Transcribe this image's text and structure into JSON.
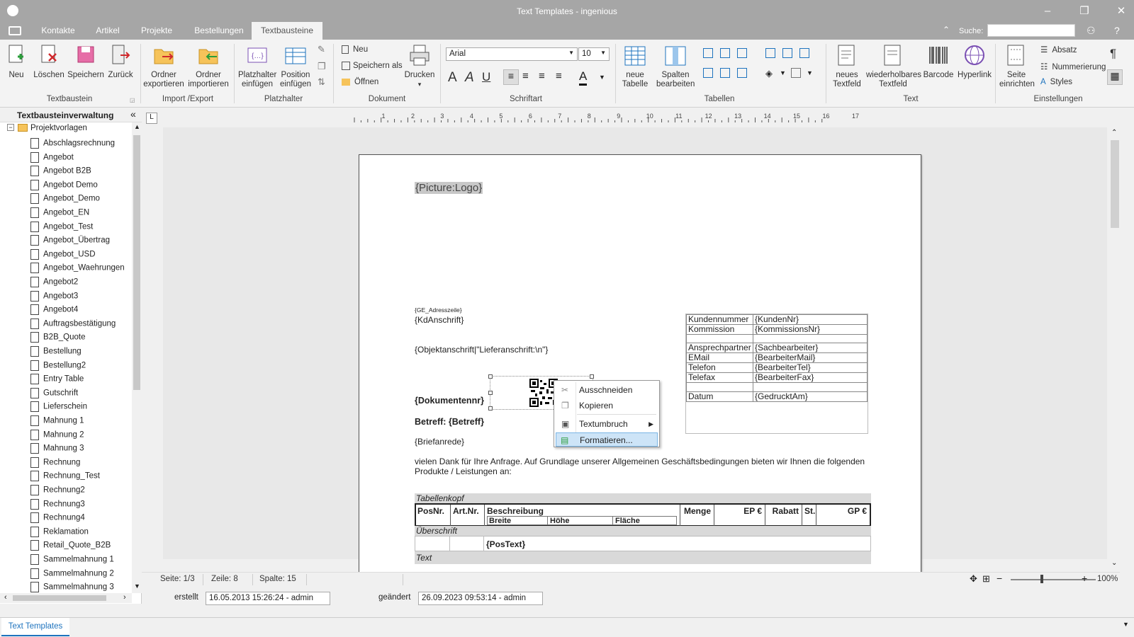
{
  "window": {
    "title": "Text Templates - ingenious"
  },
  "menu": {
    "tabs": [
      "Kontakte",
      "Artikel",
      "Projekte",
      "Bestellungen",
      "Textbausteine"
    ],
    "active": "Textbausteine",
    "search_label": "Suche:",
    "search_value": ""
  },
  "ribbon": {
    "textbaustein": {
      "group": "Textbaustein",
      "neu": "Neu",
      "loeschen": "Löschen",
      "speichern": "Speichern",
      "zurueck": "Zurück"
    },
    "importexport": {
      "group": "Import /Export",
      "export1": "Ordner",
      "export2": "exportieren",
      "import1": "Ordner",
      "import2": "importieren"
    },
    "platzhalter": {
      "group": "Platzhalter",
      "ph1": "Platzhalter",
      "ph2": "einfügen",
      "pos1": "Position",
      "pos2": "einfügen"
    },
    "dokument": {
      "group": "Dokument",
      "neu": "Neu",
      "speichern_als": "Speichern als",
      "oeffnen": "Öffnen",
      "drucken": "Drucken"
    },
    "schriftart": {
      "group": "Schriftart",
      "font": "Arial",
      "size": "10"
    },
    "tabellen": {
      "group": "Tabellen",
      "neue1": "neue",
      "neue2": "Tabelle",
      "spalten1": "Spalten",
      "spalten2": "bearbeiten"
    },
    "text": {
      "group": "Text",
      "neues1": "neues",
      "neues2": "Textfeld",
      "wieder1": "wiederholbares",
      "wieder2": "Textfeld",
      "barcode": "Barcode",
      "hyperlink": "Hyperlink"
    },
    "einstellungen": {
      "group": "Einstellungen",
      "seite1": "Seite",
      "seite2": "einrichten",
      "absatz": "Absatz",
      "nummerierung": "Nummerierung",
      "styles": "Styles"
    }
  },
  "sidebar": {
    "title": "Textbausteinverwaltung",
    "folder": "Projektvorlagen",
    "items": [
      "Abschlagsrechnung",
      "Angebot",
      "Angebot B2B",
      "Angebot Demo",
      "Angebot_Demo",
      "Angebot_EN",
      "Angebot_Test",
      "Angebot_Übertrag",
      "Angebot_USD",
      "Angebot_Waehrungen",
      "Angebot2",
      "Angebot3",
      "Angebot4",
      "Auftragsbestätigung",
      "B2B_Quote",
      "Bestellung",
      "Bestellung2",
      "Entry Table",
      "Gutschrift",
      "Lieferschein",
      "Mahnung 1",
      "Mahnung 2",
      "Mahnung 3",
      "Rechnung",
      "Rechnung_Test",
      "Rechnung2",
      "Rechnung3",
      "Rechnung4",
      "Reklamation",
      "Retail_Quote_B2B",
      "Sammelmahnung 1",
      "Sammelmahnung 2",
      "Sammelmahnung 3"
    ]
  },
  "ruler": {
    "numbers": [
      "1",
      "2",
      "3",
      "4",
      "5",
      "6",
      "7",
      "8",
      "9",
      "10",
      "11",
      "12",
      "13",
      "14",
      "15",
      "16",
      "17"
    ]
  },
  "document": {
    "logo": "{Picture:Logo}",
    "adresszeile": "{GE_Adresszeile}",
    "kdanschrift": "{KdAnschrift}",
    "objektanschrift": "{Objektanschrift|\"Lieferanschrift:\\n\"}",
    "dokumentennr": "{Dokumentennr}",
    "betreff": "Betreff: {Betreff}",
    "briefanrede": "{Briefanrede}",
    "body1": "vielen Dank für Ihre Anfrage. Auf Grundlage unserer Allgemeinen Geschäftsbedingungen bieten wir Ihnen die folgenden",
    "body2": "Produkte / Leistungen an:",
    "info_table": [
      [
        "Kundennummer",
        "{KundenNr}"
      ],
      [
        "Kommission",
        "{KommissionsNr}"
      ],
      [
        "",
        ""
      ],
      [
        "Ansprechpartner",
        "{Sachbearbeiter}"
      ],
      [
        "EMail",
        "{BearbeiterMail}"
      ],
      [
        "Telefon",
        "{BearbeiterTel}"
      ],
      [
        "Telefax",
        "{BearbeiterFax}"
      ],
      [
        "",
        ""
      ],
      [
        "Datum",
        "{GedrucktAm}"
      ]
    ],
    "tabellenkopf": "Tabellenkopf",
    "headers": {
      "posnr": "PosNr.",
      "artnr": "Art.Nr.",
      "beschreibung": "Beschreibung",
      "breite": "Breite",
      "hoehe": "Höhe",
      "flaeche": "Fläche",
      "menge": "Menge",
      "ep": "EP €",
      "rabatt": "Rabatt",
      "st": "St.",
      "gp": "GP €"
    },
    "ueberschrift": "Überschrift",
    "postext": "{PosText}",
    "text": "Text"
  },
  "context_menu": {
    "items": [
      "Ausschneiden",
      "Kopieren",
      "Textumbruch",
      "Formatieren..."
    ],
    "selected": "Formatieren..."
  },
  "status": {
    "seite": "Seite: 1/3",
    "zeile": "Zeile: 8",
    "spalte": "Spalte: 15",
    "zoom": "100%"
  },
  "meta": {
    "erstellt_label": "erstellt",
    "erstellt": "16.05.2013 15:26:24 - admin",
    "geaendert_label": "geändert",
    "geaendert": "26.09.2023 09:53:14 - admin"
  },
  "bottom_tab": "Text Templates",
  "colors": {
    "titlebar": "#a6a6a6",
    "accent": "#1e73be",
    "selection": "#cde4f7"
  }
}
